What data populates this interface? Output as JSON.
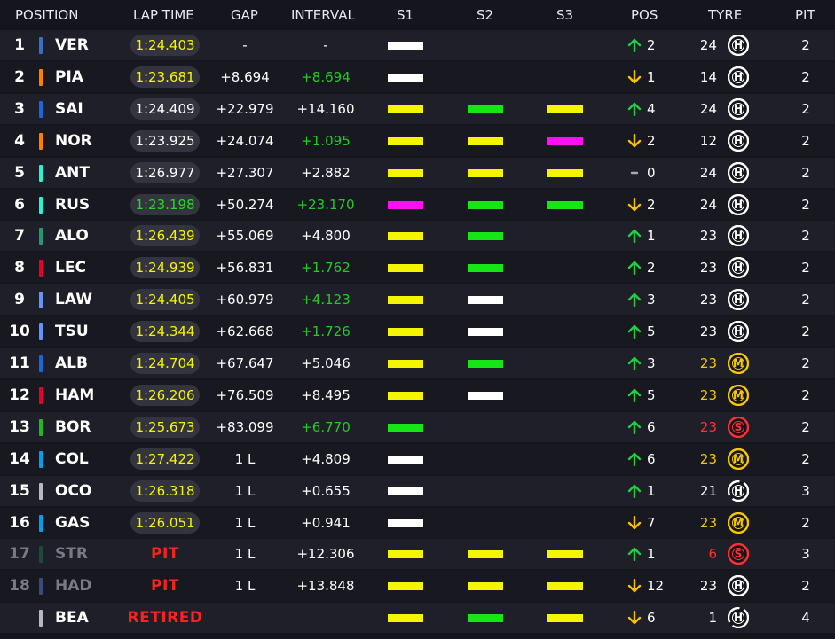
{
  "headers": {
    "position": "POSITION",
    "lap_time": "LAP TIME",
    "gap": "GAP",
    "interval": "INTERVAL",
    "s1": "S1",
    "s2": "S2",
    "s3": "S3",
    "pos": "POS",
    "tyre": "TYRE",
    "pit": "PIT"
  },
  "colors": {
    "sector_white": "#ffffff",
    "sector_yellow": "#f5f500",
    "sector_green": "#16e516",
    "sector_purple": "#ff10f0",
    "laptime_yellow": "#f5f500",
    "laptime_white": "#ffffff",
    "laptime_green": "#22dd22",
    "interval_green": "#22cc22",
    "arrow_up": "#22cc44",
    "arrow_down": "#f5c000",
    "tyre_hard": "#ffffff",
    "tyre_medium": "#f5c800",
    "tyre_soft": "#ff3030",
    "status_red": "#ff2020",
    "dim_text": "#7a7a84"
  },
  "drivers": [
    {
      "pos": "1",
      "code": "VER",
      "team_color": "#3671c6",
      "lap_time": "1:24.403",
      "lap_color": "yellow",
      "gap": "-",
      "interval": "-",
      "interval_green": false,
      "s1": "white",
      "s2": "",
      "s3": "",
      "arrow": "up",
      "pos_change": "2",
      "laps": "24",
      "laps_color": "white",
      "tyre": "hard",
      "tyre_letter": "H",
      "tyre_used": false,
      "pit": "2",
      "status": "",
      "dim": false
    },
    {
      "pos": "2",
      "code": "PIA",
      "team_color": "#ff8000",
      "lap_time": "1:23.681",
      "lap_color": "yellow",
      "gap": "+8.694",
      "interval": "+8.694",
      "interval_green": true,
      "s1": "white",
      "s2": "",
      "s3": "",
      "arrow": "down",
      "pos_change": "1",
      "laps": "14",
      "laps_color": "white",
      "tyre": "hard",
      "tyre_letter": "H",
      "tyre_used": false,
      "pit": "2",
      "status": "",
      "dim": false
    },
    {
      "pos": "3",
      "code": "SAI",
      "team_color": "#1868db",
      "lap_time": "1:24.409",
      "lap_color": "white",
      "gap": "+22.979",
      "interval": "+14.160",
      "interval_green": false,
      "s1": "yellow",
      "s2": "green",
      "s3": "yellow",
      "arrow": "up",
      "pos_change": "4",
      "laps": "24",
      "laps_color": "white",
      "tyre": "hard",
      "tyre_letter": "H",
      "tyre_used": false,
      "pit": "2",
      "status": "",
      "dim": false
    },
    {
      "pos": "4",
      "code": "NOR",
      "team_color": "#ff8000",
      "lap_time": "1:23.925",
      "lap_color": "white",
      "gap": "+24.074",
      "interval": "+1.095",
      "interval_green": true,
      "s1": "yellow",
      "s2": "yellow",
      "s3": "purple",
      "arrow": "down",
      "pos_change": "2",
      "laps": "12",
      "laps_color": "white",
      "tyre": "hard",
      "tyre_letter": "H",
      "tyre_used": false,
      "pit": "2",
      "status": "",
      "dim": false
    },
    {
      "pos": "5",
      "code": "ANT",
      "team_color": "#27f4d2",
      "lap_time": "1:26.977",
      "lap_color": "white",
      "gap": "+27.307",
      "interval": "+2.882",
      "interval_green": false,
      "s1": "yellow",
      "s2": "yellow",
      "s3": "yellow",
      "arrow": "none",
      "pos_change": "0",
      "laps": "24",
      "laps_color": "white",
      "tyre": "hard",
      "tyre_letter": "H",
      "tyre_used": false,
      "pit": "2",
      "status": "",
      "dim": false
    },
    {
      "pos": "6",
      "code": "RUS",
      "team_color": "#27f4d2",
      "lap_time": "1:23.198",
      "lap_color": "green",
      "gap": "+50.274",
      "interval": "+23.170",
      "interval_green": true,
      "s1": "purple",
      "s2": "green",
      "s3": "green",
      "arrow": "down",
      "pos_change": "2",
      "laps": "24",
      "laps_color": "white",
      "tyre": "hard",
      "tyre_letter": "H",
      "tyre_used": false,
      "pit": "2",
      "status": "",
      "dim": false
    },
    {
      "pos": "7",
      "code": "ALO",
      "team_color": "#229971",
      "lap_time": "1:26.439",
      "lap_color": "yellow",
      "gap": "+55.069",
      "interval": "+4.800",
      "interval_green": false,
      "s1": "yellow",
      "s2": "green",
      "s3": "",
      "arrow": "up",
      "pos_change": "1",
      "laps": "23",
      "laps_color": "white",
      "tyre": "hard",
      "tyre_letter": "H",
      "tyre_used": false,
      "pit": "2",
      "status": "",
      "dim": false
    },
    {
      "pos": "8",
      "code": "LEC",
      "team_color": "#e8002d",
      "lap_time": "1:24.939",
      "lap_color": "yellow",
      "gap": "+56.831",
      "interval": "+1.762",
      "interval_green": true,
      "s1": "yellow",
      "s2": "green",
      "s3": "",
      "arrow": "up",
      "pos_change": "2",
      "laps": "23",
      "laps_color": "white",
      "tyre": "hard",
      "tyre_letter": "H",
      "tyre_used": false,
      "pit": "2",
      "status": "",
      "dim": false
    },
    {
      "pos": "9",
      "code": "LAW",
      "team_color": "#6692ff",
      "lap_time": "1:24.405",
      "lap_color": "yellow",
      "gap": "+60.979",
      "interval": "+4.123",
      "interval_green": true,
      "s1": "yellow",
      "s2": "white",
      "s3": "",
      "arrow": "up",
      "pos_change": "3",
      "laps": "23",
      "laps_color": "white",
      "tyre": "hard",
      "tyre_letter": "H",
      "tyre_used": false,
      "pit": "2",
      "status": "",
      "dim": false
    },
    {
      "pos": "10",
      "code": "TSU",
      "team_color": "#6692ff",
      "lap_time": "1:24.344",
      "lap_color": "yellow",
      "gap": "+62.668",
      "interval": "+1.726",
      "interval_green": true,
      "s1": "yellow",
      "s2": "white",
      "s3": "",
      "arrow": "up",
      "pos_change": "5",
      "laps": "23",
      "laps_color": "white",
      "tyre": "hard",
      "tyre_letter": "H",
      "tyre_used": false,
      "pit": "2",
      "status": "",
      "dim": false
    },
    {
      "pos": "11",
      "code": "ALB",
      "team_color": "#1868db",
      "lap_time": "1:24.704",
      "lap_color": "yellow",
      "gap": "+67.647",
      "interval": "+5.046",
      "interval_green": false,
      "s1": "yellow",
      "s2": "green",
      "s3": "",
      "arrow": "up",
      "pos_change": "3",
      "laps": "23",
      "laps_color": "yellow",
      "tyre": "medium",
      "tyre_letter": "M",
      "tyre_used": false,
      "pit": "2",
      "status": "",
      "dim": false
    },
    {
      "pos": "12",
      "code": "HAM",
      "team_color": "#e8002d",
      "lap_time": "1:26.206",
      "lap_color": "yellow",
      "gap": "+76.509",
      "interval": "+8.495",
      "interval_green": false,
      "s1": "yellow",
      "s2": "white",
      "s3": "",
      "arrow": "up",
      "pos_change": "5",
      "laps": "23",
      "laps_color": "yellow",
      "tyre": "medium",
      "tyre_letter": "M",
      "tyre_used": false,
      "pit": "2",
      "status": "",
      "dim": false
    },
    {
      "pos": "13",
      "code": "BOR",
      "team_color": "#22b822",
      "lap_time": "1:25.673",
      "lap_color": "yellow",
      "gap": "+83.099",
      "interval": "+6.770",
      "interval_green": true,
      "s1": "green",
      "s2": "",
      "s3": "",
      "arrow": "up",
      "pos_change": "6",
      "laps": "23",
      "laps_color": "red",
      "tyre": "soft",
      "tyre_letter": "S",
      "tyre_used": false,
      "pit": "2",
      "status": "",
      "dim": false
    },
    {
      "pos": "14",
      "code": "COL",
      "team_color": "#00a1e8",
      "lap_time": "1:27.422",
      "lap_color": "yellow",
      "gap": "1 L",
      "interval": "+4.809",
      "interval_green": false,
      "s1": "white",
      "s2": "",
      "s3": "",
      "arrow": "up",
      "pos_change": "6",
      "laps": "23",
      "laps_color": "yellow",
      "tyre": "medium",
      "tyre_letter": "M",
      "tyre_used": false,
      "pit": "2",
      "status": "",
      "dim": false
    },
    {
      "pos": "15",
      "code": "OCO",
      "team_color": "#b6babd",
      "lap_time": "1:26.318",
      "lap_color": "yellow",
      "gap": "1 L",
      "interval": "+0.655",
      "interval_green": false,
      "s1": "white",
      "s2": "",
      "s3": "",
      "arrow": "up",
      "pos_change": "1",
      "laps": "21",
      "laps_color": "white",
      "tyre": "hard",
      "tyre_letter": "H",
      "tyre_used": true,
      "pit": "3",
      "status": "",
      "dim": false
    },
    {
      "pos": "16",
      "code": "GAS",
      "team_color": "#00a1e8",
      "lap_time": "1:26.051",
      "lap_color": "yellow",
      "gap": "1 L",
      "interval": "+0.941",
      "interval_green": false,
      "s1": "white",
      "s2": "",
      "s3": "",
      "arrow": "down",
      "pos_change": "7",
      "laps": "23",
      "laps_color": "yellow",
      "tyre": "medium",
      "tyre_letter": "M",
      "tyre_used": false,
      "pit": "2",
      "status": "",
      "dim": false
    },
    {
      "pos": "17",
      "code": "STR",
      "team_color": "#1d4a3a",
      "lap_time": "",
      "lap_color": "white",
      "gap": "1 L",
      "interval": "+12.306",
      "interval_green": false,
      "s1": "yellow",
      "s2": "yellow",
      "s3": "yellow",
      "arrow": "up",
      "pos_change": "1",
      "laps": "6",
      "laps_color": "red",
      "tyre": "soft",
      "tyre_letter": "S",
      "tyre_used": false,
      "pit": "3",
      "status": "PIT",
      "dim": true
    },
    {
      "pos": "18",
      "code": "HAD",
      "team_color": "#3a4a7a",
      "lap_time": "",
      "lap_color": "white",
      "gap": "1 L",
      "interval": "+13.848",
      "interval_green": false,
      "s1": "yellow",
      "s2": "yellow",
      "s3": "yellow",
      "arrow": "down",
      "pos_change": "12",
      "laps": "23",
      "laps_color": "white",
      "tyre": "hard",
      "tyre_letter": "H",
      "tyre_used": false,
      "pit": "2",
      "status": "PIT",
      "dim": true
    },
    {
      "pos": "",
      "code": "BEA",
      "team_color": "#b6babd",
      "lap_time": "",
      "lap_color": "white",
      "gap": "",
      "interval": "",
      "interval_green": false,
      "s1": "yellow",
      "s2": "green",
      "s3": "yellow",
      "arrow": "down",
      "pos_change": "6",
      "laps": "1",
      "laps_color": "white",
      "tyre": "hard",
      "tyre_letter": "H",
      "tyre_used": true,
      "pit": "4",
      "status": "RETIRED",
      "dim": false
    }
  ]
}
